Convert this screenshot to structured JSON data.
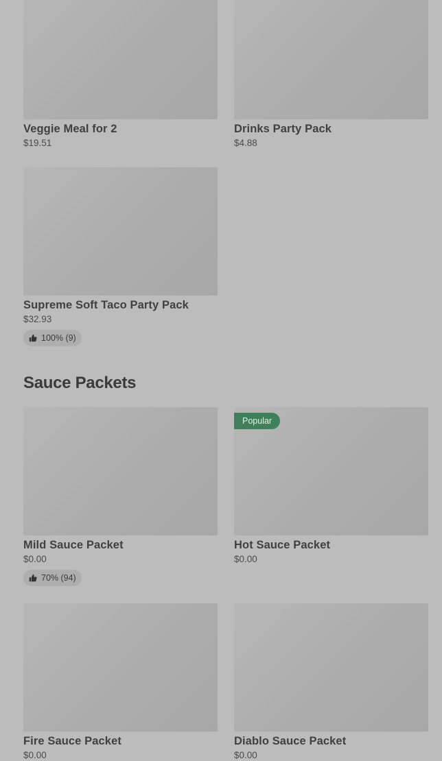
{
  "items_top": [
    {
      "name": "Veggie Meal for 2",
      "price": "$19.51"
    },
    {
      "name": "Drinks Party Pack",
      "price": "$4.88"
    },
    {
      "name": "Supreme Soft Taco Party Pack",
      "price": "$32.93",
      "rating": "100% (9)"
    }
  ],
  "section": {
    "title": "Sauce Packets"
  },
  "sauces": [
    {
      "name": "Mild Sauce Packet",
      "price": "$0.00",
      "rating": "70% (94)"
    },
    {
      "name": "Hot Sauce Packet",
      "price": "$0.00",
      "badge": "Popular"
    },
    {
      "name": "Fire Sauce Packet",
      "price": "$0.00"
    },
    {
      "name": "Diablo Sauce Packet",
      "price": "$0.00"
    }
  ],
  "icons": {
    "rating": "thumbs-up-icon"
  }
}
